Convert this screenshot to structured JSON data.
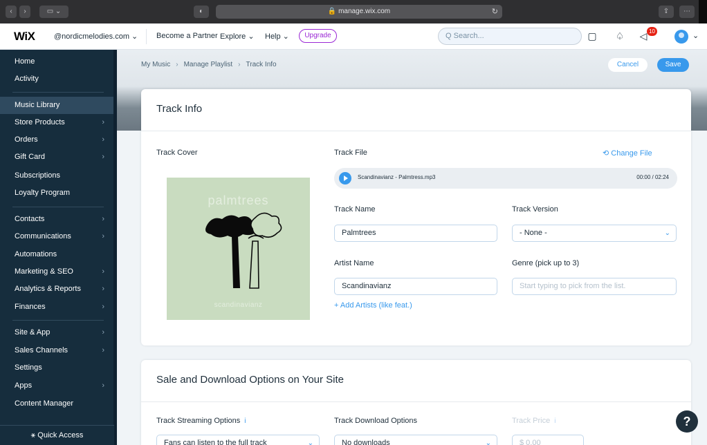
{
  "browser": {
    "url": "manage.wix.com",
    "back_glyph": "‹",
    "forward_glyph": "›",
    "sidebar_toggle_glyph": "▭ ⌄",
    "shield_glyph": "◐",
    "reload_glyph": "↻",
    "share_glyph": "⇪",
    "menu_glyph": "⋯"
  },
  "topbar": {
    "logo": "WiX",
    "site": "@nordicmelodies.com ⌄",
    "become_partner": "Become a Partner",
    "explore": "Explore ⌄",
    "help": "Help ⌄",
    "upgrade": "Upgrade",
    "search_placeholder": "Q Search...",
    "chat_icon": "▢",
    "bell_icon": "♤",
    "megaphone_icon": "◁",
    "notification_count": "10",
    "avatar_chevron": "⌄"
  },
  "sidebar": {
    "items": [
      {
        "label": "Home",
        "arrow": ""
      },
      {
        "label": "Activity",
        "arrow": ""
      },
      {
        "label": "Music Library",
        "arrow": ""
      },
      {
        "label": "Store Products",
        "arrow": "›"
      },
      {
        "label": "Orders",
        "arrow": "›"
      },
      {
        "label": "Gift Card",
        "arrow": "›"
      },
      {
        "label": "Subscriptions",
        "arrow": ""
      },
      {
        "label": "Loyalty Program",
        "arrow": ""
      },
      {
        "label": "Contacts",
        "arrow": "›"
      },
      {
        "label": "Communications",
        "arrow": "›"
      },
      {
        "label": "Automations",
        "arrow": ""
      },
      {
        "label": "Marketing & SEO",
        "arrow": "›"
      },
      {
        "label": "Analytics & Reports",
        "arrow": "›"
      },
      {
        "label": "Finances",
        "arrow": "›"
      },
      {
        "label": "Site & App",
        "arrow": "›"
      },
      {
        "label": "Sales Channels",
        "arrow": "›"
      },
      {
        "label": "Settings",
        "arrow": ""
      },
      {
        "label": "Apps",
        "arrow": "›"
      },
      {
        "label": "Content Manager",
        "arrow": ""
      }
    ],
    "quick_access": "⚹ Quick Access"
  },
  "header": {
    "breadcrumb": [
      "My Music",
      "Manage Playlist",
      "Track Info"
    ],
    "breadcrumb_sep": "›",
    "cancel": "Cancel",
    "save": "Save"
  },
  "track_info": {
    "title": "Track Info",
    "track_cover_label": "Track Cover",
    "cover_title": "palmtrees",
    "cover_artist": "scandinavianz",
    "track_file_label": "Track File",
    "change_file": "⟲ Change File",
    "file_name": "Scandinavianz - Palmtress.mp3",
    "file_time": "00:00 / 02:24",
    "track_name_label": "Track Name",
    "track_name_value": "Palmtrees",
    "track_version_label": "Track Version",
    "track_version_value": "- None -",
    "artist_name_label": "Artist Name",
    "artist_name_value": "Scandinavianz",
    "genre_label": "Genre (pick up to 3)",
    "genre_placeholder": "Start typing to pick from the list.",
    "add_artists": "+ Add Artists (like feat.)"
  },
  "sale_options": {
    "title": "Sale and Download Options on Your Site",
    "streaming_label": "Track Streaming Options",
    "streaming_value": "Fans can listen to the full track",
    "download_label": "Track Download Options",
    "download_value": "No downloads",
    "price_label": "Track Price",
    "price_value": "$ 0.00",
    "info_glyph": "i"
  },
  "help_button": "?",
  "colors": {
    "accent": "#3899ec",
    "sidebar_bg": "#162d3d",
    "upgrade": "#9a27d5",
    "badge": "#e62214"
  }
}
